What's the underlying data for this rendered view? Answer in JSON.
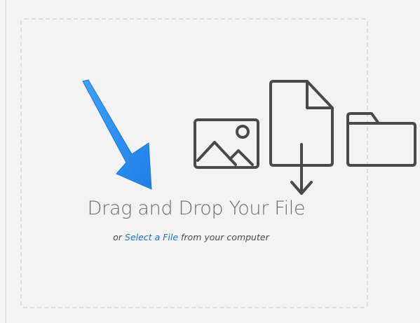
{
  "dropzone": {
    "title": "Drag and Drop Your File",
    "subtitle_prefix": "or ",
    "select_link": "Select a File",
    "subtitle_suffix": " from your computer"
  },
  "icons": [
    "image-icon",
    "file-download-icon",
    "folder-icon",
    "arrow-pointer-icon"
  ],
  "colors": {
    "link": "#1a73c9",
    "arrow": "#2f8df0",
    "icon_stroke": "#4a4a4a",
    "title": "#6b6b6b",
    "dashed_border": "#dcdcdc",
    "background": "#f3f3f3"
  }
}
